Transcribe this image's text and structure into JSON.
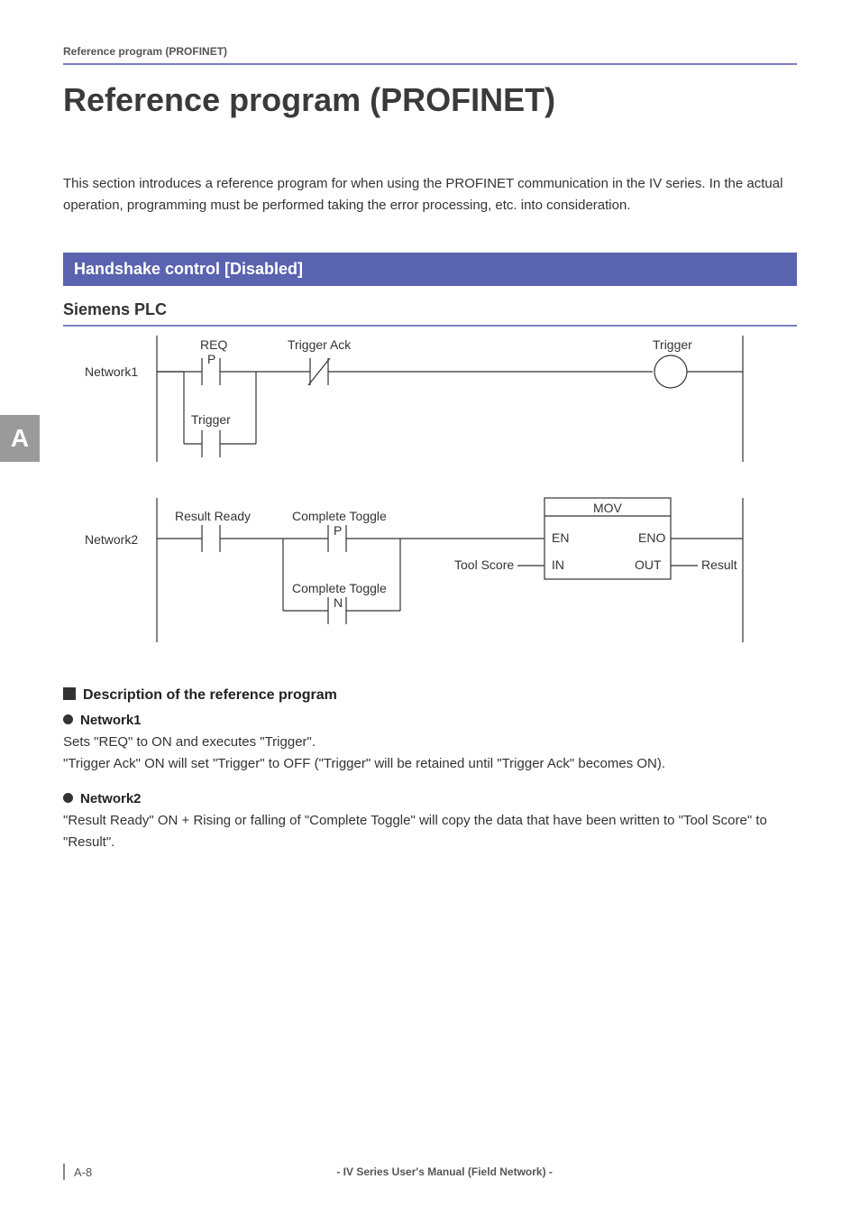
{
  "running_header": "Reference program (PROFINET)",
  "h1": "Reference program (PROFINET)",
  "intro": "This section introduces a reference program for when using the PROFINET communication in the IV series. In the actual operation, programming must be performed taking the error processing, etc. into consideration.",
  "blue_bar": "Handshake control [Disabled]",
  "section_title": "Siemens PLC",
  "side_tab": "A",
  "diagram": {
    "network1": "Network1",
    "network2": "Network2",
    "req": "REQ",
    "p1": "P",
    "trigger_ack": "Trigger Ack",
    "trigger_coil": "Trigger",
    "trigger_contact": "Trigger",
    "result_ready": "Result Ready",
    "complete_toggle_p": "Complete Toggle",
    "p2": "P",
    "complete_toggle_n": "Complete Toggle",
    "n": "N",
    "mov": "MOV",
    "en": "EN",
    "eno": "ENO",
    "in": "IN",
    "out": "OUT",
    "tool_score": "Tool Score",
    "result": "Result"
  },
  "desc_heading": "Description of the reference program",
  "net1_heading": "Network1",
  "net1_body": "Sets \"REQ\" to ON and executes \"Trigger\".\n\"Trigger Ack\" ON will set \"Trigger\" to OFF (\"Trigger\" will be retained until \"Trigger Ack\" becomes ON).",
  "net2_heading": "Network2",
  "net2_body": "\"Result Ready\" ON + Rising or falling of \"Complete Toggle\" will copy the data that have been written to \"Tool Score\" to \"Result\".",
  "footer": {
    "page": "A-8",
    "center": "- IV Series User's Manual (Field Network) -"
  }
}
